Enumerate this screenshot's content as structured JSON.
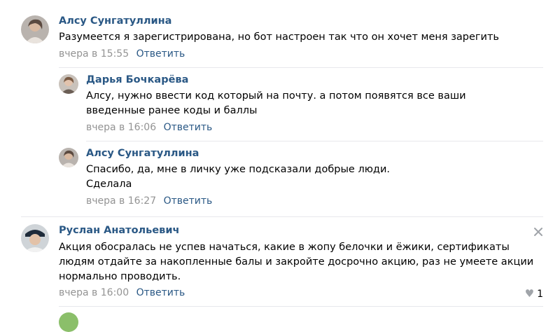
{
  "reply_label": "Ответить",
  "comments": [
    {
      "author": "Алсу Сунгатуллина",
      "text": "Разумеется я зарегистрирована, но бот настроен так что он хочет меня зарегить",
      "date": "вчера в 15:55"
    },
    {
      "author": "Дарья Бочкарёва",
      "text": "Алсу, нужно ввести код который на почту. а потом появятся все ваши введенные ранее коды и баллы",
      "date": "вчера в 16:06"
    },
    {
      "author": "Алсу Сунгатуллина",
      "text_lines": [
        "Спасибо, да, мне в личку уже подсказали добрые люди.",
        "Сделала"
      ],
      "date": "вчера в 16:27"
    },
    {
      "author": "Руслан Анатольевич",
      "text": "Акция обосралась не успев начаться, какие в жопу белочки и ёжики, сертификаты людям отдайте за накопленные балы и закройте досрочно акцию, раз не умеете акции нормально проводить.",
      "date": "вчера в 16:00",
      "likes": "1"
    }
  ],
  "colors": {
    "link": "#2a5885",
    "meta": "#939393",
    "divider": "#e7e8ec",
    "icon": "#a0a4a9"
  },
  "icons": [
    "close-icon",
    "heart-icon"
  ]
}
